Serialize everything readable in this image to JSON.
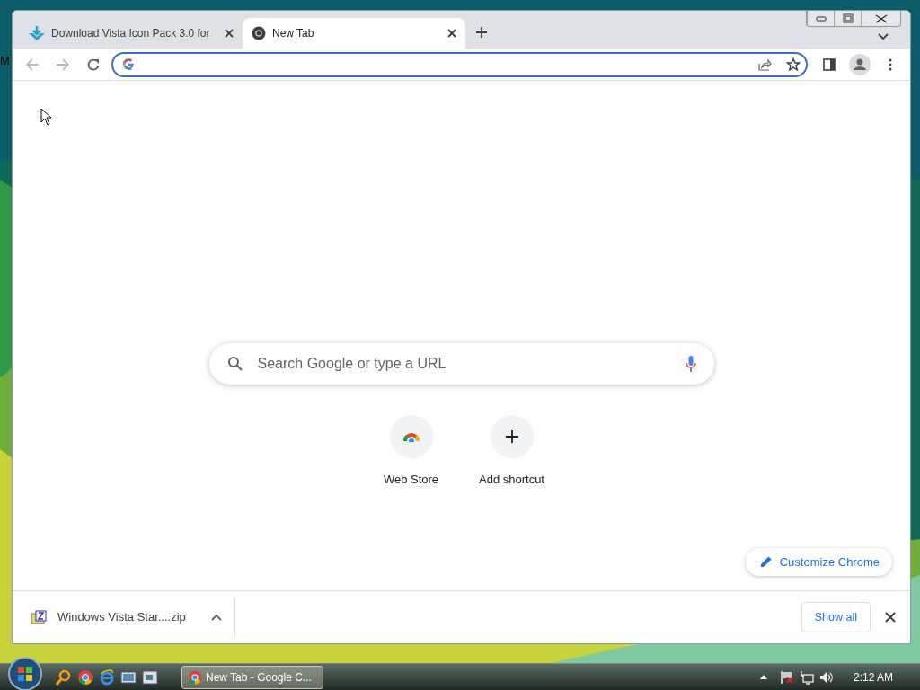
{
  "desktop": {
    "icon_label": "M"
  },
  "tabs": [
    {
      "title": "Download Vista Icon Pack 3.0 for",
      "kind": "site",
      "selected": false
    },
    {
      "title": "New Tab",
      "kind": "chrome",
      "selected": true
    }
  ],
  "toolbar": {
    "back": {
      "disabled": true
    },
    "forward": {
      "disabled": true
    },
    "omnibox": {
      "focused": true
    }
  },
  "search": {
    "placeholder": "Search Google or type a URL"
  },
  "shortcuts": [
    {
      "label": "Web Store",
      "kind": "webstore"
    },
    {
      "label": "Add shortcut",
      "kind": "add"
    }
  ],
  "customize_button": "Customize Chrome",
  "downloads": {
    "items": [
      {
        "filename": "Windows Vista Star....zip"
      }
    ],
    "show_all": "Show all"
  },
  "taskbar": {
    "windows": [
      {
        "label": "New Tab - Google C...",
        "selected": true
      }
    ],
    "clock": "2:12 AM"
  }
}
